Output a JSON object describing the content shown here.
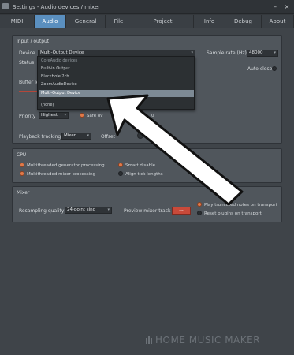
{
  "window": {
    "title": "Settings - Audio devices / mixer",
    "controls": {
      "minimize": "–",
      "close": "×"
    }
  },
  "tabs": [
    {
      "label": "MIDI"
    },
    {
      "label": "Audio"
    },
    {
      "label": "General"
    },
    {
      "label": "File"
    },
    {
      "label": "Project"
    },
    {
      "label": "Info"
    },
    {
      "label": "Debug"
    },
    {
      "label": "About"
    }
  ],
  "active_tab": "Audio",
  "input_output": {
    "section_title": "Input / output",
    "device_label": "Device",
    "device_value": "Multi-Output Device",
    "sample_rate_label": "Sample rate (Hz)",
    "sample_rate_value": "48000",
    "status_label": "Status",
    "auto_close_label": "Auto close",
    "buffer_label": "Buffer le",
    "priority_label": "Priority",
    "priority_value": "Highest",
    "safe_label": "Safe ov",
    "safe_suffix": "0",
    "dropdown": {
      "header": "CoreAudio devices",
      "items": [
        "Built-in Output",
        "BlackHole 2ch",
        "ZoomAudioDevice",
        "Multi-Output Device"
      ],
      "selected": "Multi-Output Device",
      "none_item": "(none)"
    }
  },
  "playback": {
    "tracking_label": "Playback tracking",
    "tracking_value": "Mixer",
    "offset_label": "Offset"
  },
  "cpu": {
    "section_title": "CPU",
    "options": [
      {
        "label": "Multithreaded generator processing",
        "checked": true
      },
      {
        "label": "Smart disable",
        "checked": true
      },
      {
        "label": "Multithreaded mixer processing",
        "checked": true
      },
      {
        "label": "Align tick lengths",
        "checked": false
      }
    ]
  },
  "mixer": {
    "section_title": "Mixer",
    "resampling_label": "Resampling quality",
    "resampling_value": "24-point sinc",
    "preview_label": "Preview mixer track",
    "preview_value": "---",
    "options": [
      {
        "label": "Play truncated notes on transport",
        "checked": true
      },
      {
        "label": "Reset plugins on transport",
        "checked": false
      }
    ]
  },
  "watermark": "HOME MUSIC MAKER",
  "colors": {
    "accent": "#5a8fbf",
    "radio_on": "#e07a4a",
    "preview_button": "#c94a3a",
    "arrow_fill": "#ffffff",
    "arrow_outline": "#111111"
  }
}
